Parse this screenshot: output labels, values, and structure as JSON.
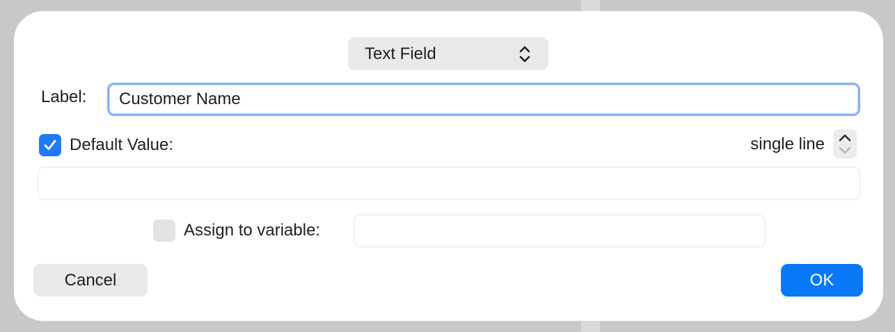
{
  "dialog": {
    "type_select": {
      "value": "Text Field",
      "icon": "chevron-up-down-icon"
    },
    "label_field": {
      "label": "Label:",
      "value": "Customer Name"
    },
    "default_value": {
      "checked": true,
      "label": "Default Value:",
      "mode": "single line",
      "value": ""
    },
    "assign_variable": {
      "checked": false,
      "label": "Assign to variable:",
      "value": ""
    },
    "buttons": {
      "cancel": "Cancel",
      "ok": "OK"
    },
    "colors": {
      "accent": "#0a79f8",
      "checkbox_checked": "#1f7af4",
      "focus_ring": "#86b2f4"
    }
  }
}
